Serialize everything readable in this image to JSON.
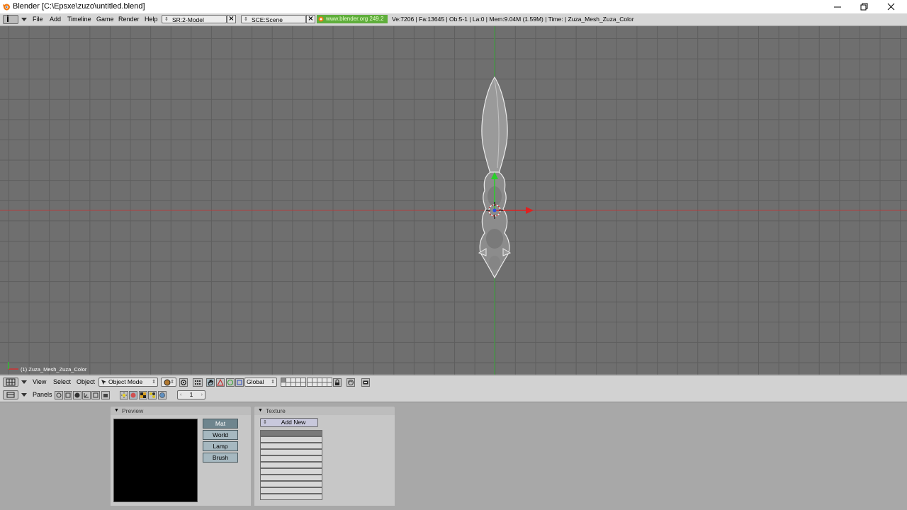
{
  "window": {
    "title": "Blender [C:\\Epsxe\\zuzo\\untitled.blend]"
  },
  "info_header": {
    "menus": [
      "File",
      "Add",
      "Timeline",
      "Game",
      "Render",
      "Help"
    ],
    "screen_field": "SR:2-Model",
    "scene_field": "SCE:Scene",
    "url_badge": "www.blender.org 249.2",
    "stats": "Ve:7206 | Fa:13645 | Ob:5-1 | La:0 | Mem:9.04M (1.59M) | Time: | Zuza_Mesh_Zuza_Color"
  },
  "viewport": {
    "object_label": "(1) Zuza_Mesh_Zuza_Color"
  },
  "view3d_header": {
    "menus": [
      "View",
      "Select",
      "Object"
    ],
    "mode": "Object Mode",
    "orientation": "Global"
  },
  "buttons_header": {
    "panels_label": "Panels",
    "frame": "1"
  },
  "preview_panel": {
    "title": "Preview",
    "buttons": [
      "Mat",
      "World",
      "Lamp",
      "Brush"
    ],
    "active": "Mat"
  },
  "texture_panel": {
    "title": "Texture",
    "add_new": "Add New"
  },
  "colors": {
    "viewport_bg": "#6f6f6f",
    "grid": "#5e5e5e",
    "x_axis": "#c03030",
    "y_axis": "#30b030",
    "badge_green": "#5fae3c"
  }
}
